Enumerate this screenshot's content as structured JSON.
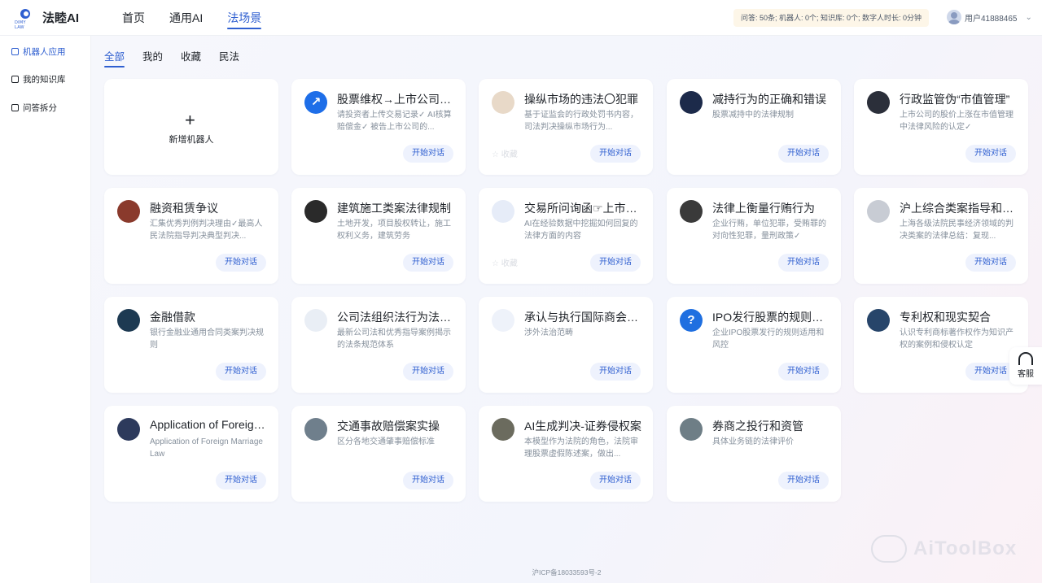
{
  "header": {
    "logo_text": "法睦AI",
    "logo_sub": "DIMY LAW",
    "nav": [
      {
        "label": "首页",
        "active": false
      },
      {
        "label": "通用AI",
        "active": false
      },
      {
        "label": "法场景",
        "active": true
      }
    ],
    "quota": "问答: 50条; 机器人: 0个; 知识库: 0个; 数字人时长: 0分钟",
    "user_name": "用户41888465",
    "user_chevron": "⌄"
  },
  "sidebar": {
    "items": [
      {
        "label": "机器人应用",
        "active": true
      },
      {
        "label": "我的知识库",
        "active": false
      },
      {
        "label": "问答拆分",
        "active": false
      }
    ],
    "collapse_glyph": "◀"
  },
  "tabs": [
    {
      "label": "全部",
      "active": true
    },
    {
      "label": "我的",
      "active": false
    },
    {
      "label": "收藏",
      "active": false
    },
    {
      "label": "民法",
      "active": false
    }
  ],
  "add_card": {
    "plus": "+",
    "label": "新增机器人"
  },
  "chat_label": "开始对话",
  "fav_label": "☆ 收藏",
  "cards": [
    {
      "title": "股票维权→上市公司虚假陈述",
      "desc": "请投资者上传交易记录✓ AI核算赔偿金✓ 被告上市公司的...",
      "avatar_color": "#1e6ee8",
      "avatar_glyph": "↗"
    },
    {
      "title": "操纵市场的违法〇犯罪",
      "desc": "基于证监会的行政处罚书内容，司法判决操纵市场行为...",
      "avatar_color": "#e8d9c8",
      "avatar_glyph": "",
      "fav": true
    },
    {
      "title": "减持行为的正确和错误",
      "desc": "股票减持中的法律规制",
      "avatar_color": "#1c2a4a",
      "avatar_glyph": ""
    },
    {
      "title": "行政监管伪“市值管理”",
      "desc": "上市公司的股价上涨在市值管理中法律风险的认定✓",
      "avatar_color": "#2b2f3a",
      "avatar_glyph": ""
    },
    {
      "title": "融资租赁争议",
      "desc": "汇集优秀判例判决理由✓最高人民法院指导判决典型判决...",
      "avatar_color": "#8a3a2c",
      "avatar_glyph": ""
    },
    {
      "title": "建筑施工类案法律规制",
      "desc": "土地开发，项目股权转让，施工权利义务，建筑劳务",
      "avatar_color": "#2a2a2a",
      "avatar_glyph": ""
    },
    {
      "title": "交易所问询函☞上市公司信息披露",
      "desc": "AI在经验数据中挖掘如何回复的法律方面的内容",
      "avatar_color": "#e6ecf8",
      "avatar_glyph": "",
      "fav": true
    },
    {
      "title": "法律上衡量行贿行为",
      "desc": "企业行贿，单位犯罪，受贿罪的对向性犯罪，量刑政策✓",
      "avatar_color": "#3a3a3a",
      "avatar_glyph": ""
    },
    {
      "title": "沪上综合类案指导和总结",
      "desc": "上海各级法院民事经济领域的判决类案的法律总结：复现...",
      "avatar_color": "#c8ccd4",
      "avatar_glyph": ""
    },
    {
      "title": "金融借款",
      "desc": "银行金融业通用合同类案判决规则",
      "avatar_color": "#1d3a52",
      "avatar_glyph": ""
    },
    {
      "title": "公司法组织法行为法专业问答",
      "desc": "最新公司法和优秀指导案例揭示的法条规范体系",
      "avatar_color": "#e9eef5",
      "avatar_glyph": ""
    },
    {
      "title": "承认与执行国际商会仲裁裁决",
      "desc": "涉外法治范畴",
      "avatar_color": "#eef2fa",
      "avatar_glyph": ""
    },
    {
      "title": "IPO发行股票的规则适用和风控",
      "desc": "企业IPO股票发行的规则适用和风控",
      "avatar_color": "#1f6fe0",
      "avatar_glyph": "?"
    },
    {
      "title": "专利权和现实契合",
      "desc": "认识专利商标著作权作为知识产权的案例和侵权认定",
      "avatar_color": "#27456a",
      "avatar_glyph": ""
    },
    {
      "title": "Application of Foreign Marriage Law",
      "desc": "Application of Foreign Marriage Law",
      "avatar_color": "#2d3a5c",
      "avatar_glyph": ""
    },
    {
      "title": "交通事故赔偿案实操",
      "desc": "区分各地交通肇事赔偿标准",
      "avatar_color": "#6f7f8c",
      "avatar_glyph": ""
    },
    {
      "title": "AI生成判决-证券侵权案",
      "desc": "本模型作为法院的角色，法院审理股票虚假陈述案，做出...",
      "avatar_color": "#6b6b5e",
      "avatar_glyph": ""
    },
    {
      "title": "券商之投行和资管",
      "desc": "具体业务链的法律评价",
      "avatar_color": "#6e7e86",
      "avatar_glyph": ""
    }
  ],
  "footer_icp": "沪ICP备18033593号-2",
  "watermark": "AiToolBox",
  "service_label": "客服"
}
